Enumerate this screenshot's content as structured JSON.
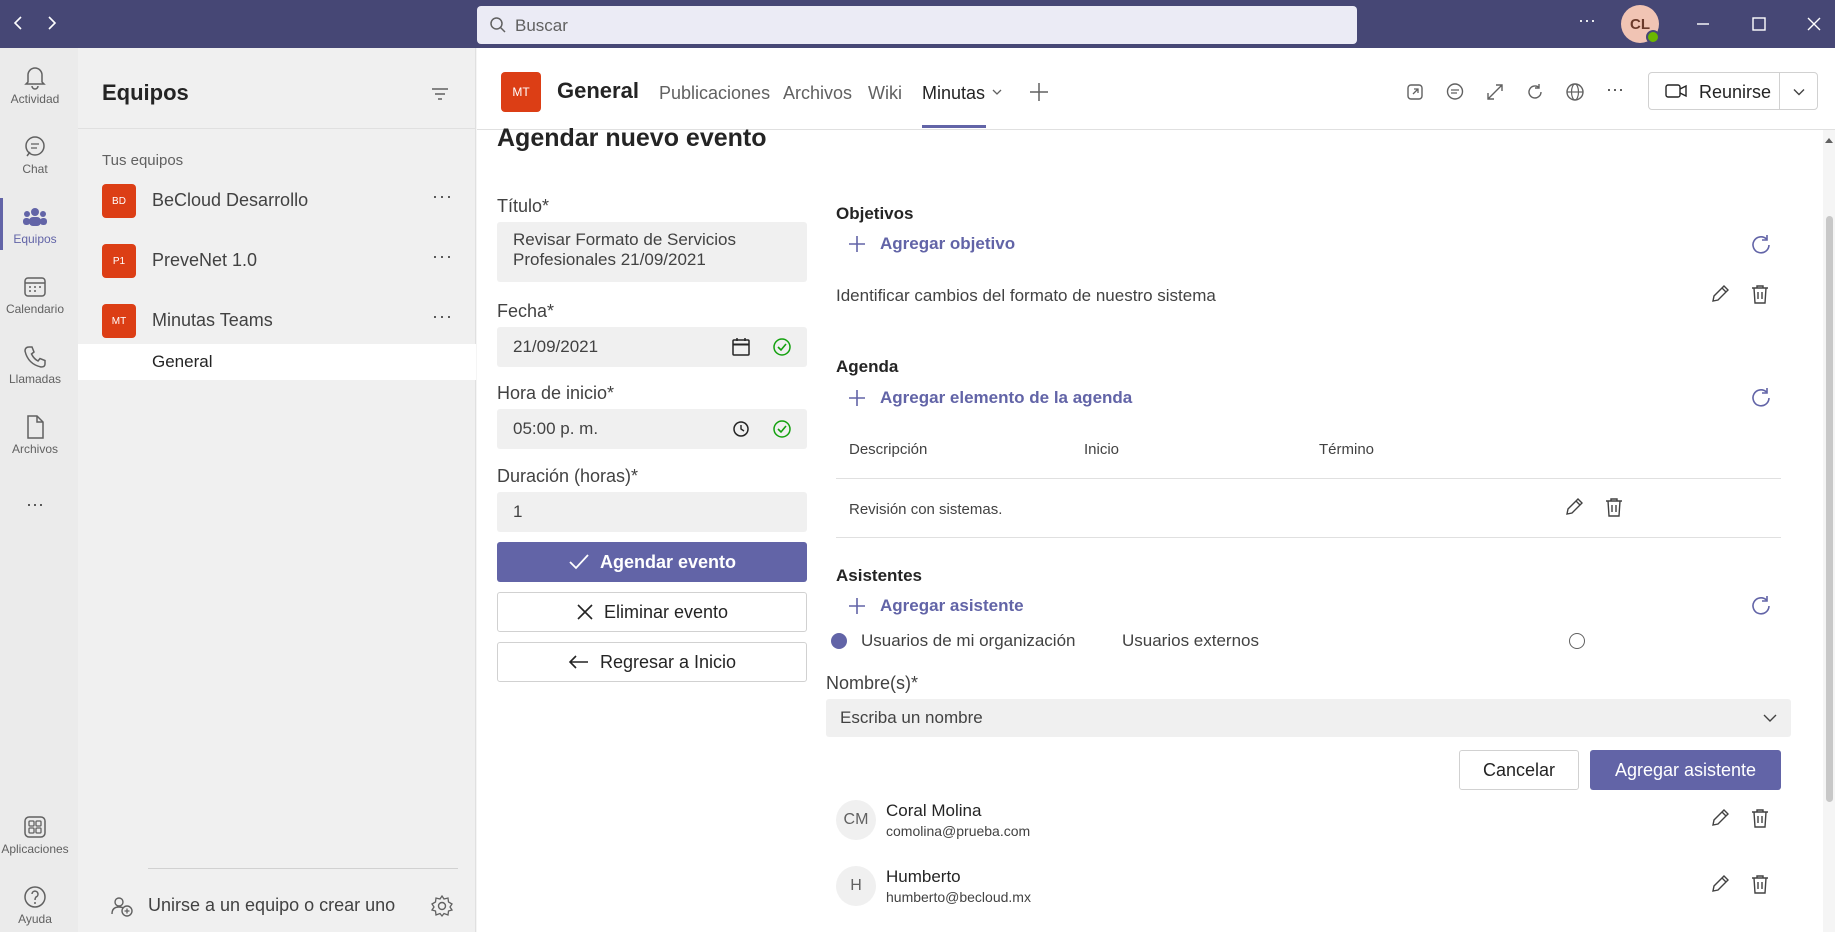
{
  "titlebar": {
    "search_placeholder": "Buscar",
    "more": "···",
    "user_initials": "CL"
  },
  "rail": {
    "items": [
      {
        "label": "Actividad",
        "icon": "bell-icon"
      },
      {
        "label": "Chat",
        "icon": "chat-icon"
      },
      {
        "label": "Equipos",
        "icon": "teams-icon"
      },
      {
        "label": "Calendario",
        "icon": "calendar-icon"
      },
      {
        "label": "Llamadas",
        "icon": "phone-icon"
      },
      {
        "label": "Archivos",
        "icon": "file-icon"
      }
    ],
    "more": "···",
    "apps_label": "Aplicaciones",
    "help_label": "Ayuda"
  },
  "teams_panel": {
    "title": "Equipos",
    "section_label": "Tus equipos",
    "teams": [
      {
        "initials": "BD",
        "name": "BeCloud Desarrollo"
      },
      {
        "initials": "P1",
        "name": "PreveNet 1.0"
      },
      {
        "initials": "MT",
        "name": "Minutas Teams"
      }
    ],
    "more": "···",
    "channel": "General",
    "join_label": "Unirse a un equipo o crear uno"
  },
  "channel_header": {
    "avatar_initials": "MT",
    "name": "General",
    "tabs": [
      "Publicaciones",
      "Archivos",
      "Wiki",
      "Minutas"
    ],
    "active_tab": "Minutas",
    "meet_label": "Reunirse"
  },
  "form": {
    "heading": "Agendar nuevo evento",
    "title_label": "Título*",
    "title_value": "Revisar Formato de Servicios Profesionales 21/09/2021",
    "date_label": "Fecha*",
    "date_value": "21/09/2021",
    "start_label": "Hora de inicio*",
    "start_value": "05:00 p. m.",
    "duration_label": "Duración (horas)*",
    "duration_value": "1",
    "schedule_btn": "Agendar evento",
    "delete_btn": "Eliminar evento",
    "back_btn": "Regresar a Inicio"
  },
  "objectives": {
    "title": "Objetivos",
    "add_label": "Agregar objetivo",
    "items": [
      "Identificar cambios del formato de nuestro sistema"
    ]
  },
  "agenda": {
    "title": "Agenda",
    "add_label": "Agregar elemento de la agenda",
    "columns": [
      "Descripción",
      "Inicio",
      "Término"
    ],
    "rows": [
      {
        "description": "Revisión con sistemas.",
        "start": "",
        "end": ""
      }
    ]
  },
  "attendees": {
    "title": "Asistentes",
    "add_label": "Agregar asistente",
    "radio_org": "Usuarios de mi organización",
    "radio_ext": "Usuarios externos",
    "names_label": "Nombre(s)*",
    "names_placeholder": "Escriba un nombre",
    "cancel_btn": "Cancelar",
    "add_btn": "Agregar asistente",
    "people": [
      {
        "initials": "CM",
        "name": "Coral Molina",
        "email": "comolina@prueba.com"
      },
      {
        "initials": "H",
        "name": "Humberto",
        "email": "humberto@becloud.mx"
      }
    ]
  },
  "colors": {
    "brand": "#6264a7",
    "titlebar": "#464775",
    "team_avatar": "#dc3e15"
  }
}
